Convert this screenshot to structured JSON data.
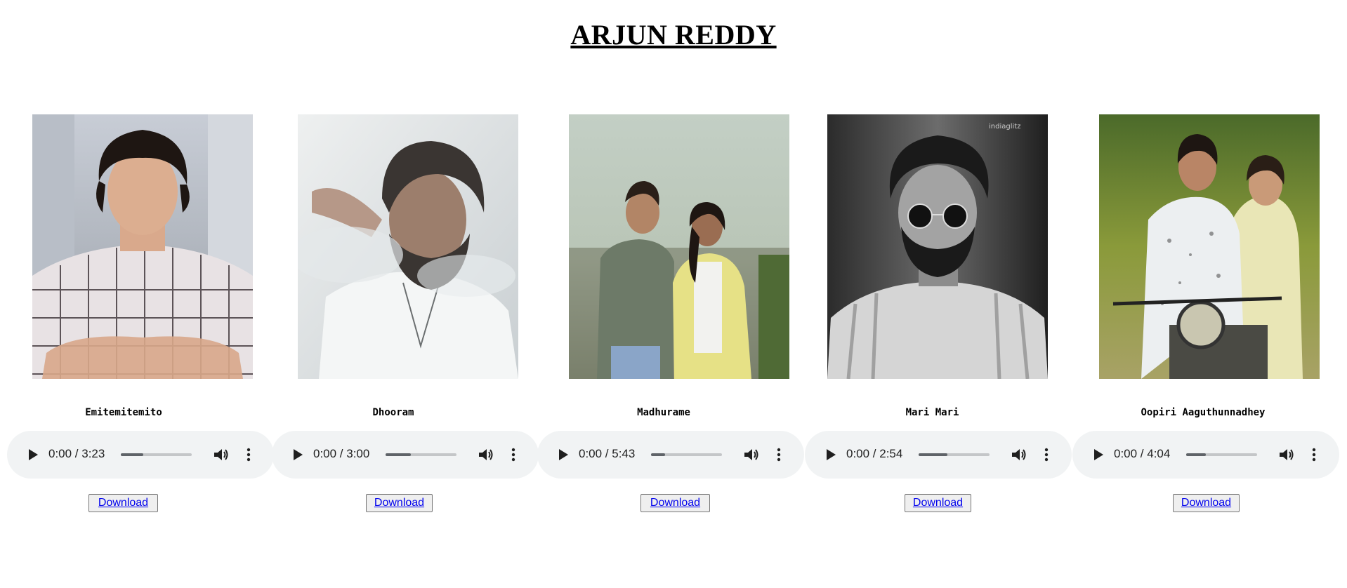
{
  "page": {
    "title": "ARJUN REDDY"
  },
  "songs": [
    {
      "title": "Emitemitemito",
      "time": "0:00 / 3:23",
      "progress": 0.32,
      "download_label": "Download",
      "image_icon": "portrait-photo"
    },
    {
      "title": "Dhooram",
      "time": "0:00 / 3:00",
      "progress": 0.36,
      "download_label": "Download",
      "image_icon": "portrait-photo"
    },
    {
      "title": "Madhurame",
      "time": "0:00 / 5:43",
      "progress": 0.2,
      "download_label": "Download",
      "image_icon": "couple-photo"
    },
    {
      "title": "Mari Mari",
      "time": "0:00 / 2:54",
      "progress": 0.41,
      "download_label": "Download",
      "image_icon": "portrait-photo"
    },
    {
      "title": "Oopiri Aaguthunnadhey",
      "time": "0:00 / 4:04",
      "progress": 0.28,
      "download_label": "Download",
      "image_icon": "couple-photo"
    }
  ],
  "player_icons": {
    "play": "play-icon",
    "volume": "volume-icon",
    "menu": "more-vertical-icon"
  }
}
